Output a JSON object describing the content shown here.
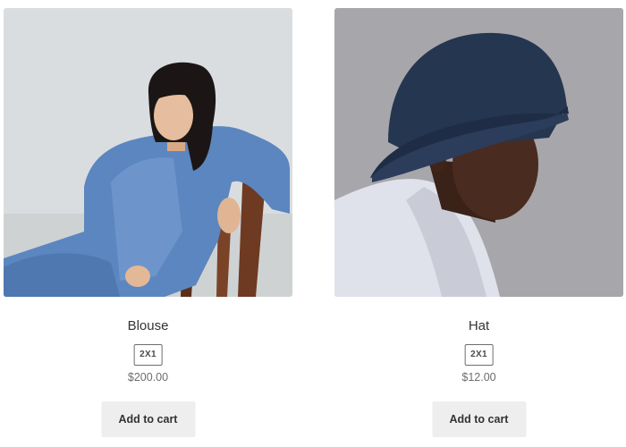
{
  "products": [
    {
      "name": "Blouse",
      "badge": "2X1",
      "price": "$200.00",
      "button_label": "Add to cart",
      "image_alt": "blouse-photo"
    },
    {
      "name": "Hat",
      "badge": "2X1",
      "price": "$12.00",
      "button_label": "Add to cart",
      "image_alt": "hat-photo"
    }
  ],
  "colors": {
    "button_bg": "#eeeeee",
    "text": "#333333",
    "price": "#6d6d6d",
    "badge_border": "#6d6d6d"
  }
}
